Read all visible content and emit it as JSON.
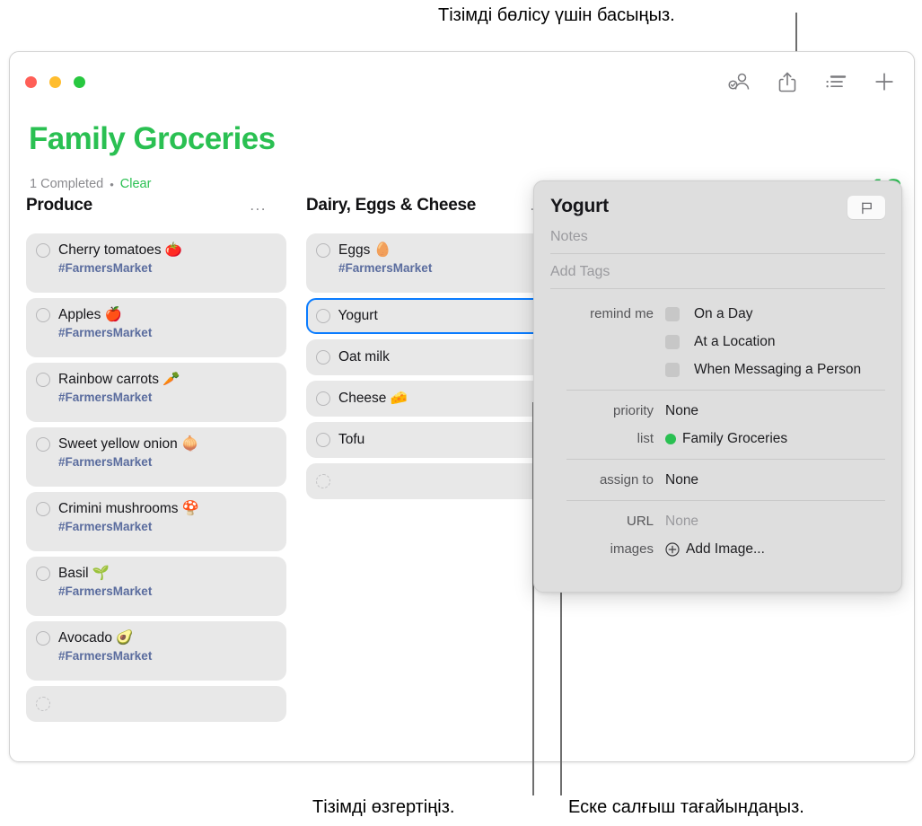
{
  "callouts": {
    "top": "Тізімді бөлісу үшін басыңыз.",
    "bottom_left": "Тізімді өзгертіңіз.",
    "bottom_right": "Еске салғыш тағайындаңыз."
  },
  "window": {
    "traffic_lights": [
      "close",
      "minimize",
      "zoom"
    ],
    "toolbar": [
      {
        "name": "assigned-reminders-icon",
        "label": "Assigned Reminders"
      },
      {
        "name": "share-icon",
        "label": "Share"
      },
      {
        "name": "list-view-icon",
        "label": "View Options"
      },
      {
        "name": "add-icon",
        "label": "New Reminder"
      }
    ]
  },
  "list": {
    "title": "Family Groceries",
    "title_color": "#2ac052",
    "completed_text": "1 Completed",
    "separator": "•",
    "clear_label": "Clear"
  },
  "columns": [
    {
      "title": "Produce",
      "menu": "...",
      "items": [
        {
          "label": "Cherry tomatoes 🍅",
          "tag": "#FarmersMarket",
          "selected": false
        },
        {
          "label": "Apples 🍎",
          "tag": "#FarmersMarket",
          "selected": false
        },
        {
          "label": "Rainbow carrots 🥕",
          "tag": "#FarmersMarket",
          "selected": false
        },
        {
          "label": "Sweet yellow onion 🧅",
          "tag": "#FarmersMarket",
          "selected": false
        },
        {
          "label": "Crimini mushrooms 🍄",
          "tag": "#FarmersMarket",
          "selected": false
        },
        {
          "label": "Basil 🌱",
          "tag": "#FarmersMarket",
          "selected": false
        },
        {
          "label": "Avocado 🥑",
          "tag": "#FarmersMarket",
          "selected": false
        },
        {
          "label": "",
          "tag": "",
          "selected": false,
          "empty": true
        }
      ]
    },
    {
      "title": "Dairy, Eggs & Cheese",
      "menu": "...",
      "items": [
        {
          "label": "Eggs 🥚",
          "tag": "#FarmersMarket",
          "selected": false
        },
        {
          "label": "Yogurt",
          "tag": "",
          "selected": true,
          "info_badge": true
        },
        {
          "label": "Oat milk",
          "tag": "",
          "selected": false
        },
        {
          "label": "Cheese 🧀",
          "tag": "",
          "selected": false
        },
        {
          "label": "Tofu",
          "tag": "",
          "selected": false
        },
        {
          "label": "",
          "tag": "",
          "selected": false,
          "empty": true
        }
      ]
    }
  ],
  "popover": {
    "title": "Yogurt",
    "flag_icon": "flag-icon",
    "notes_placeholder": "Notes",
    "tags_placeholder": "Add Tags",
    "remind_me_label": "remind me",
    "remind_options": [
      {
        "label": "On a Day",
        "checked": false
      },
      {
        "label": "At a Location",
        "checked": false
      },
      {
        "label": "When Messaging a Person",
        "checked": false
      }
    ],
    "priority_label": "priority",
    "priority_value": "None",
    "list_label": "list",
    "list_value": "Family Groceries",
    "list_color": "#2ac052",
    "assign_to_label": "assign to",
    "assign_to_value": "None",
    "url_label": "URL",
    "url_value": "None",
    "images_label": "images",
    "images_value": "Add Image..."
  }
}
